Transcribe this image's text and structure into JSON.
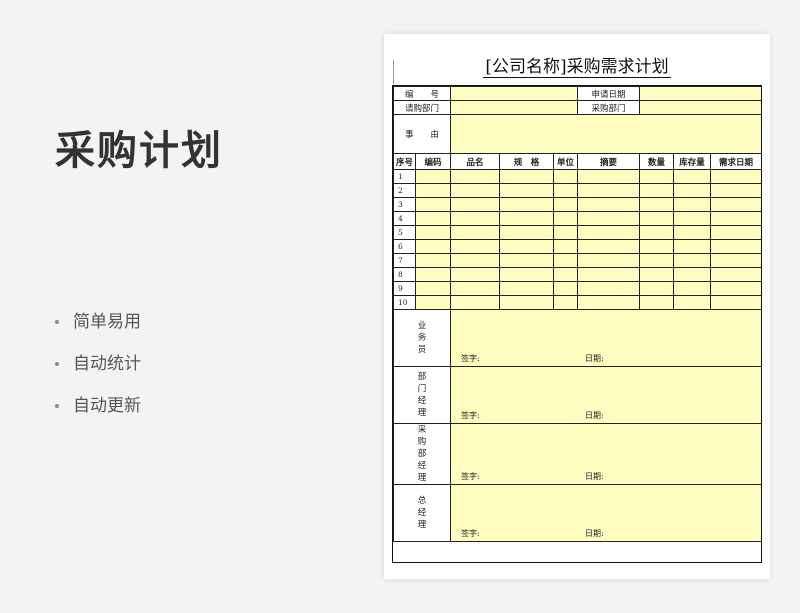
{
  "title": "采购计划",
  "features": [
    "简单易用",
    "自动统计",
    "自动更新"
  ],
  "sheet": {
    "title": "[公司名称]采购需求计划",
    "labels": {
      "number": "编　　号",
      "apply_date": "申请日期",
      "dept": "请购部门",
      "purchase_dept": "采购部门",
      "reason": "事　　由"
    },
    "columns": [
      "序号",
      "编码",
      "品名",
      "规　格",
      "单位",
      "摘要",
      "数量",
      "库存量",
      "需求日期"
    ],
    "rows": [
      "1",
      "2",
      "3",
      "4",
      "5",
      "6",
      "7",
      "8",
      "9",
      "10"
    ],
    "signatures": [
      {
        "role": "业务员",
        "sign": "签字:",
        "date": "日期:"
      },
      {
        "role": "部门经理",
        "sign": "签字:",
        "date": "日期:"
      },
      {
        "role": "采购部经理",
        "sign": "签字:",
        "date": "日期:"
      },
      {
        "role": "总经理",
        "sign": "签字:",
        "date": "日期:"
      }
    ]
  },
  "colors": {
    "fill": "#fffcc0",
    "background": "#f3f3f5"
  }
}
